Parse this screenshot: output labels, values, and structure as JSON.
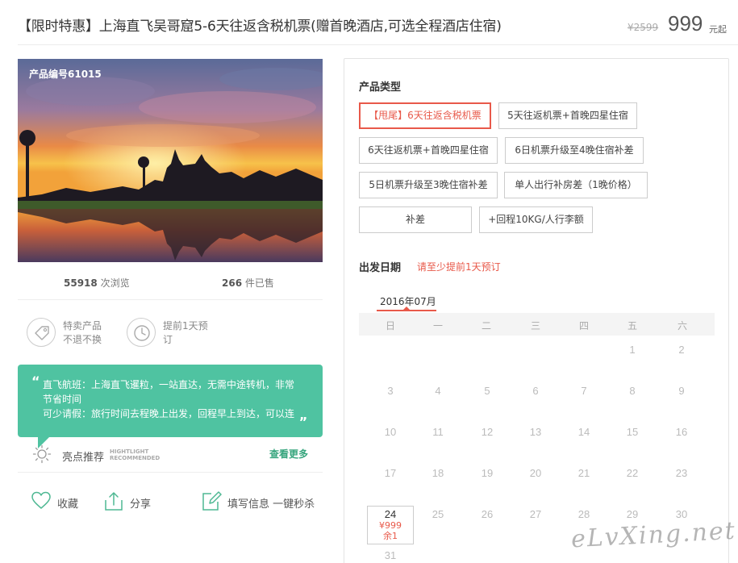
{
  "header": {
    "title": "【限时特惠】上海直飞吴哥窟5-6天往返含税机票(赠首晚酒店,可选全程酒店住宿)",
    "old_price": "¥2599",
    "price": "999",
    "price_unit": "元起"
  },
  "photo": {
    "product_code": "产品编号61015"
  },
  "stats": {
    "views_num": "55918",
    "views_label": "次浏览",
    "sold_num": "266",
    "sold_label": "件已售"
  },
  "badges": [
    {
      "icon": "price-tag-icon",
      "line1": "特卖产品",
      "line2": "不退不换"
    },
    {
      "icon": "clock-icon",
      "line1": "提前1天预",
      "line2": "订"
    }
  ],
  "highlight": {
    "line1": "直飞航班：上海直飞暹粒，一站直达，无需中途转机，非常",
    "line2": "节省时间",
    "line3": "可少请假：旅行时间去程晚上出发，回程早上到达，可以连",
    "title": "亮点推荐",
    "sub1": "HIGHTLIGHT",
    "sub2": "RECOMMENDED",
    "more": "查看更多"
  },
  "actions": {
    "favorite": "收藏",
    "share": "分享",
    "fill_info": "填写信息 一键秒杀"
  },
  "product_type": {
    "label": "产品类型",
    "options": [
      "【甩尾】6天往返含税机票",
      "5天往返机票+首晚四星住宿",
      "6天往返机票+首晚四星住宿",
      "6日机票升级至4晚住宿补差",
      "5日机票升级至3晚住宿补差",
      "单人出行补房差（1晚价格）",
      "补差",
      "+回程10KG/人行李额"
    ],
    "selected_index": 0
  },
  "departure": {
    "label": "出发日期",
    "hint": "请至少提前1天预订",
    "month": "2016年07月",
    "weekdays": [
      "日",
      "一",
      "二",
      "三",
      "四",
      "五",
      "六"
    ],
    "selected_day": {
      "day": "24",
      "price": "¥999",
      "remaining": "余1"
    }
  },
  "watermark": "eLvXing.net",
  "colors": {
    "accent": "#e8594a",
    "highlight_green": "#4fc3a1",
    "link_green": "#36a57d"
  }
}
